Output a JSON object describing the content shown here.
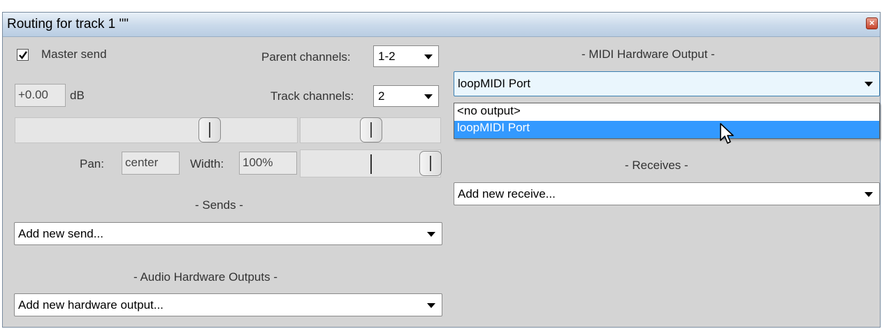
{
  "window": {
    "title": "Routing for track 1 \"\"",
    "close_icon": "close-icon"
  },
  "master_send": {
    "label": "Master send",
    "checked": true
  },
  "parent_channels": {
    "label": "Parent channels:",
    "value": "1-2"
  },
  "track_channels": {
    "label": "Track channels:",
    "value": "2"
  },
  "volume": {
    "value": "+0.00",
    "unit": "dB"
  },
  "pan": {
    "label": "Pan:",
    "value": "center"
  },
  "width": {
    "label": "Width:",
    "value": "100%"
  },
  "sends": {
    "header": "- Sends -",
    "combo": "Add new send..."
  },
  "audio_hw": {
    "header": "- Audio Hardware Outputs -",
    "combo": "Add new hardware output..."
  },
  "midi_hw": {
    "header": "- MIDI Hardware Output -",
    "selected": "loopMIDI Port",
    "options": [
      "<no output>",
      "loopMIDI Port"
    ],
    "highlighted_index": 1
  },
  "receives": {
    "header": "- Receives -",
    "combo": "Add new receive..."
  },
  "colors": {
    "panel": "#d4d4d4",
    "highlight": "#3399ff",
    "titlebar": "#c9d9ea"
  }
}
